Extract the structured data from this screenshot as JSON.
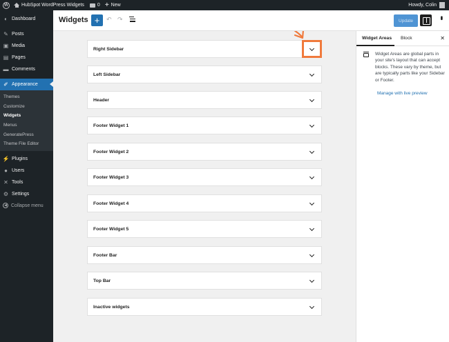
{
  "adminbar": {
    "site_name": "HubSpot WordPress Widgets",
    "comments_count": "0",
    "new_label": "New",
    "howdy": "Howdy, Colin"
  },
  "sidebar": {
    "items": [
      {
        "label": "Dashboard",
        "icon": "dashboard-icon"
      },
      {
        "label": "Posts",
        "icon": "pin-icon"
      },
      {
        "label": "Media",
        "icon": "media-icon"
      },
      {
        "label": "Pages",
        "icon": "page-icon"
      },
      {
        "label": "Comments",
        "icon": "comment-icon"
      },
      {
        "label": "Appearance",
        "icon": "brush-icon"
      }
    ],
    "submenu": [
      "Themes",
      "Customize",
      "Widgets",
      "Menus",
      "GeneratePress",
      "Theme File Editor"
    ],
    "items_after": [
      {
        "label": "Plugins",
        "icon": "plug-icon"
      },
      {
        "label": "Users",
        "icon": "user-icon"
      },
      {
        "label": "Tools",
        "icon": "wrench-icon"
      },
      {
        "label": "Settings",
        "icon": "settings-icon"
      }
    ],
    "collapse_label": "Collapse menu"
  },
  "header": {
    "title": "Widgets",
    "update_label": "Update"
  },
  "widget_areas": [
    "Right Sidebar",
    "Left Sidebar",
    "Header",
    "Footer Widget 1",
    "Footer Widget 2",
    "Footer Widget 3",
    "Footer Widget 4",
    "Footer Widget 5",
    "Footer Bar",
    "Top Bar",
    "Inactive widgets"
  ],
  "panel": {
    "tab_widget_areas": "Widget Areas",
    "tab_block": "Block",
    "description": "Widget Areas are global parts in your site's layout that can accept blocks. These vary by theme, but are typically parts like your Sidebar or Footer.",
    "link": "Manage with live preview"
  },
  "colors": {
    "accent": "#2271b1",
    "highlight": "#f07a3c",
    "admin_dark": "#1d2327"
  }
}
